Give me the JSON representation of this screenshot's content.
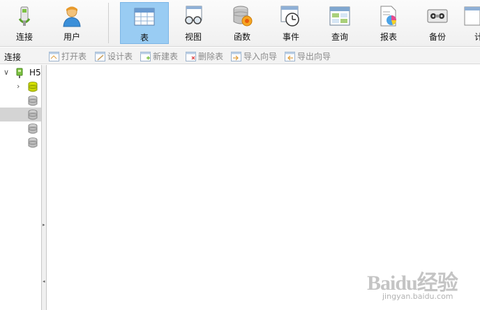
{
  "toolbar": {
    "items": [
      {
        "label": "连接",
        "icon": "connect-plug-icon"
      },
      {
        "label": "用户",
        "icon": "user-icon"
      },
      {
        "label": "表",
        "icon": "table-icon"
      },
      {
        "label": "视图",
        "icon": "view-glasses-icon"
      },
      {
        "label": "函数",
        "icon": "function-database-icon"
      },
      {
        "label": "事件",
        "icon": "event-clock-icon"
      },
      {
        "label": "查询",
        "icon": "query-table-icon"
      },
      {
        "label": "报表",
        "icon": "report-chart-icon"
      },
      {
        "label": "备份",
        "icon": "backup-tape-icon"
      },
      {
        "label": "计",
        "icon": "schedule-icon"
      }
    ],
    "active": "表"
  },
  "subbar": {
    "title": "连接",
    "items": [
      {
        "label": "打开表",
        "icon": "open-table-icon"
      },
      {
        "label": "设计表",
        "icon": "design-table-icon"
      },
      {
        "label": "新建表",
        "icon": "new-table-icon"
      },
      {
        "label": "删除表",
        "icon": "delete-table-icon"
      },
      {
        "label": "导入向导",
        "icon": "import-wizard-icon"
      },
      {
        "label": "导出向导",
        "icon": "export-wizard-icon"
      }
    ]
  },
  "tree": {
    "connection_label": "H5",
    "databases": [
      {
        "state": "open"
      },
      {
        "state": "closed"
      },
      {
        "state": "closed",
        "selected": true
      },
      {
        "state": "closed"
      },
      {
        "state": "closed"
      }
    ]
  },
  "watermark": {
    "brand": "Baidu经验",
    "url": "jingyan.baidu.com"
  },
  "colors": {
    "active_tab_bg": "#99ccf3",
    "selected_row": "#d4d4d4",
    "db_open": "#c8d400"
  }
}
